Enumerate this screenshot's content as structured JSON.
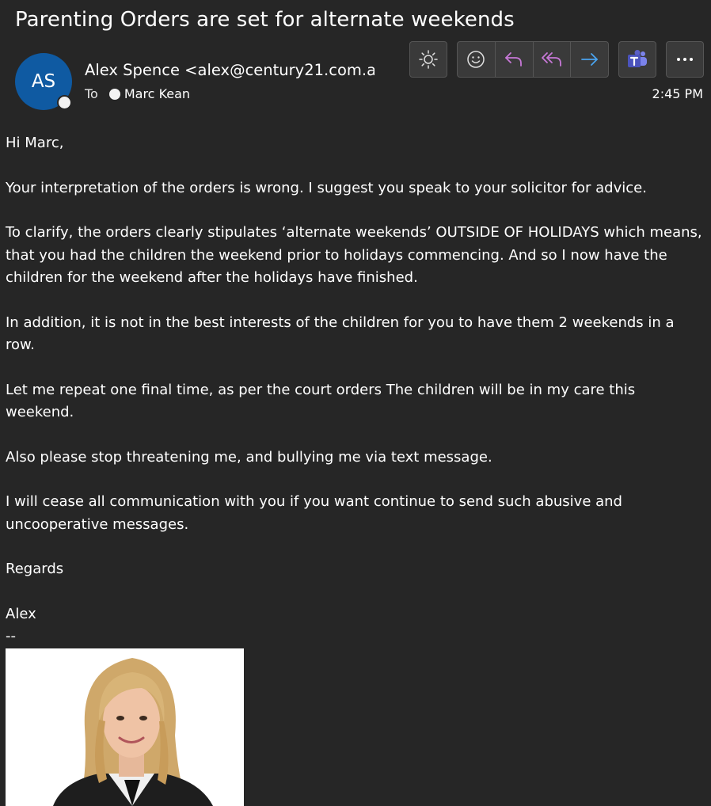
{
  "email": {
    "subject": "Parenting Orders are set for alternate weekends",
    "avatar_initials": "AS",
    "sender": "Alex Spence <alex@century21.com.au",
    "to_label": "To",
    "recipient": "Marc Kean",
    "time": "2:45 PM"
  },
  "toolbar": {
    "items": [
      {
        "icon": "brightness-icon"
      },
      {
        "icon": "emoji-icon"
      },
      {
        "icon": "reply-icon"
      },
      {
        "icon": "reply-all-icon"
      },
      {
        "icon": "forward-icon"
      },
      {
        "icon": "teams-icon"
      },
      {
        "icon": "more-icon"
      }
    ]
  },
  "body": {
    "greeting": "Hi Marc,",
    "p1": "Your interpretation of the orders is wrong. I suggest you speak to your solicitor for advice.",
    "p2": "To clarify, the orders clearly stipulates ‘alternate weekends’ OUTSIDE OF HOLIDAYS which means, that you had the children the weekend prior to holidays commencing. And so I now have the children for the weekend after the holidays have finished.",
    "p3": "In addition, it is not in the best interests of the children for you to have them 2 weekends in a row.",
    "p4": "Let me repeat one final time, as per the court orders The children will be in my care this weekend.",
    "p5": "Also please stop threatening me, and bullying me via text message.",
    "p6": "I will cease all communication with you if you want continue to send such abusive and uncooperative messages.",
    "closing": "Regards",
    "name": "Alex",
    "sig_sep": "--"
  },
  "colors": {
    "background": "#262626",
    "avatar": "#0f5aa2",
    "reply_accent": "#c878d8",
    "forward_accent": "#4aa3ef",
    "teams": "#5b5fc7"
  }
}
